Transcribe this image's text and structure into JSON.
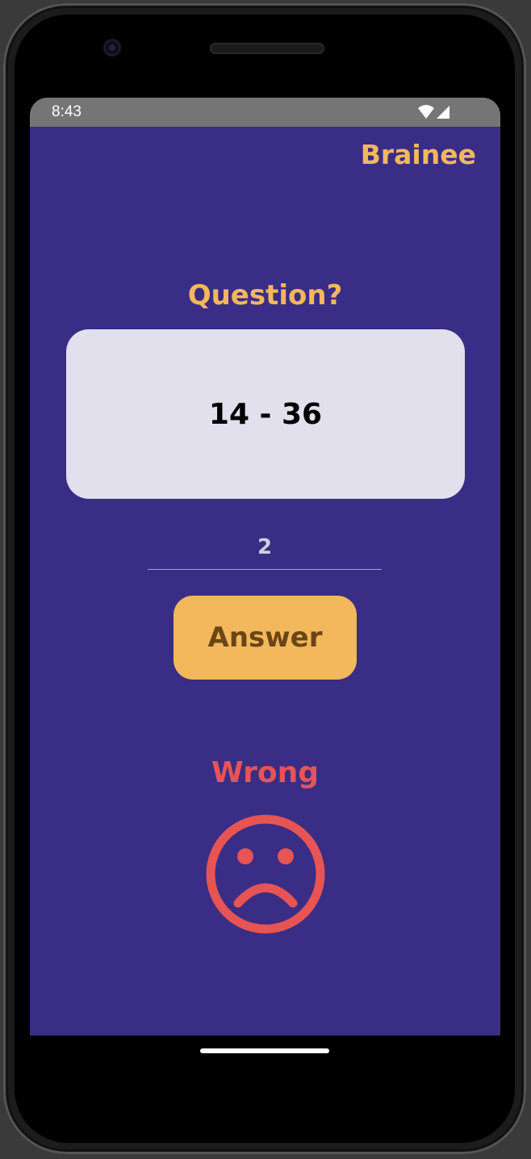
{
  "status_bar": {
    "time": "8:43",
    "icons": [
      "wifi-icon",
      "cellular-signal-icon"
    ]
  },
  "app": {
    "brand": "Brainee"
  },
  "question": {
    "label": "Question?",
    "expression": "14 - 36"
  },
  "answer": {
    "value": "2",
    "button_label": "Answer"
  },
  "result": {
    "label": "Wrong",
    "icon": "sad-face-icon"
  },
  "colors": {
    "background": "#3a2d85",
    "accent": "#f3b75c",
    "card": "#e1e0ec",
    "error": "#e65454",
    "status_bar": "#757575"
  }
}
